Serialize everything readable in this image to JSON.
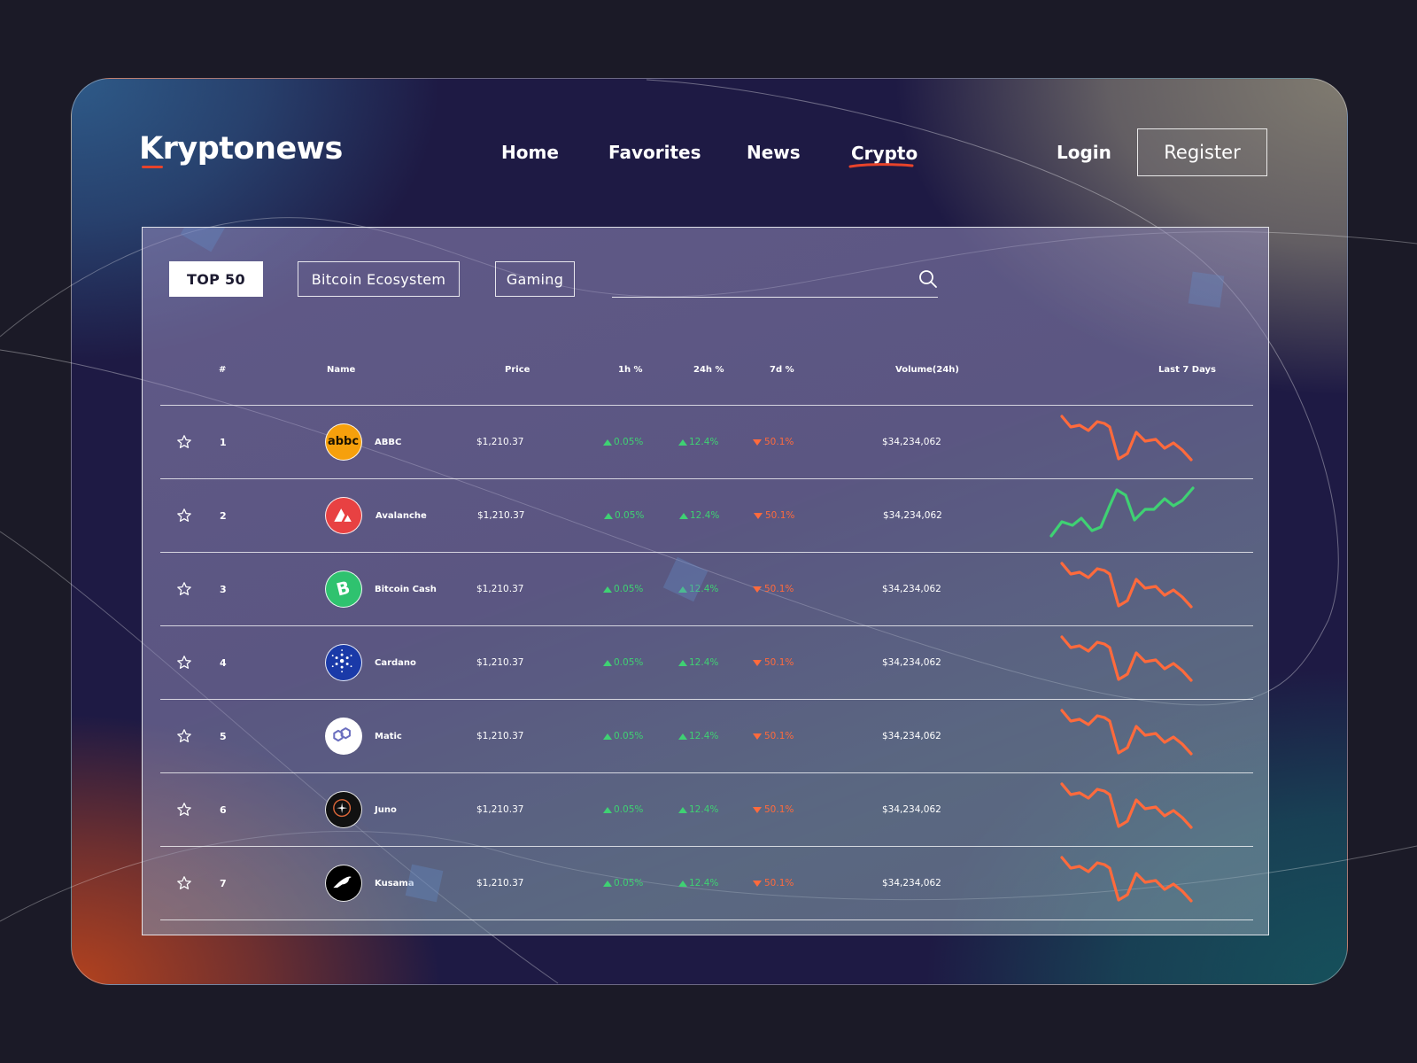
{
  "brand": {
    "name": "Kryptonews",
    "accent": "#e8432b"
  },
  "nav": {
    "items": [
      {
        "label": "Home"
      },
      {
        "label": "Favorites"
      },
      {
        "label": "News"
      },
      {
        "label": "Crypto",
        "active": true
      }
    ],
    "login_label": "Login",
    "register_label": "Register"
  },
  "filters": {
    "tabs": [
      {
        "label": "TOP 50",
        "active": true
      },
      {
        "label": "Bitcoin Ecosystem"
      },
      {
        "label": "Gaming"
      }
    ],
    "search": {
      "placeholder": "",
      "value": "",
      "icon": "search-icon"
    }
  },
  "table": {
    "headers": {
      "rank": "#",
      "name": "Name",
      "price": "Price",
      "h1": "1h %",
      "h24": "24h %",
      "d7": "7d %",
      "volume": "Volume(24h)",
      "chart": "Last 7 Days"
    },
    "rows": [
      {
        "rank": "1",
        "name": "ABBC",
        "icon": "abbc-logo-icon",
        "price": "$1,210.37",
        "h1": "0.05%",
        "h24": "12.4%",
        "d7": "50.1%",
        "volume": "$34,234,062",
        "trend": "down"
      },
      {
        "rank": "2",
        "name": "Avalanche",
        "icon": "avalanche-logo-icon",
        "price": "$1,210.37",
        "h1": "0.05%",
        "h24": "12.4%",
        "d7": "50.1%",
        "volume": "$34,234,062",
        "trend": "up"
      },
      {
        "rank": "3",
        "name": "Bitcoin Cash",
        "icon": "bitcoin-cash-logo-icon",
        "price": "$1,210.37",
        "h1": "0.05%",
        "h24": "12.4%",
        "d7": "50.1%",
        "volume": "$34,234,062",
        "trend": "down"
      },
      {
        "rank": "4",
        "name": "Cardano",
        "icon": "cardano-logo-icon",
        "price": "$1,210.37",
        "h1": "0.05%",
        "h24": "12.4%",
        "d7": "50.1%",
        "volume": "$34,234,062",
        "trend": "down"
      },
      {
        "rank": "5",
        "name": "Matic",
        "icon": "matic-logo-icon",
        "price": "$1,210.37",
        "h1": "0.05%",
        "h24": "12.4%",
        "d7": "50.1%",
        "volume": "$34,234,062",
        "trend": "down"
      },
      {
        "rank": "6",
        "name": "Juno",
        "icon": "juno-logo-icon",
        "price": "$1,210.37",
        "h1": "0.05%",
        "h24": "12.4%",
        "d7": "50.1%",
        "volume": "$34,234,062",
        "trend": "down"
      },
      {
        "rank": "7",
        "name": "Kusama",
        "icon": "kusama-logo-icon",
        "price": "$1,210.37",
        "h1": "0.05%",
        "h24": "12.4%",
        "d7": "50.1%",
        "volume": "$34,234,062",
        "trend": "down"
      }
    ]
  },
  "colors": {
    "positive": "#3fd173",
    "negative": "#ff6a3c"
  }
}
